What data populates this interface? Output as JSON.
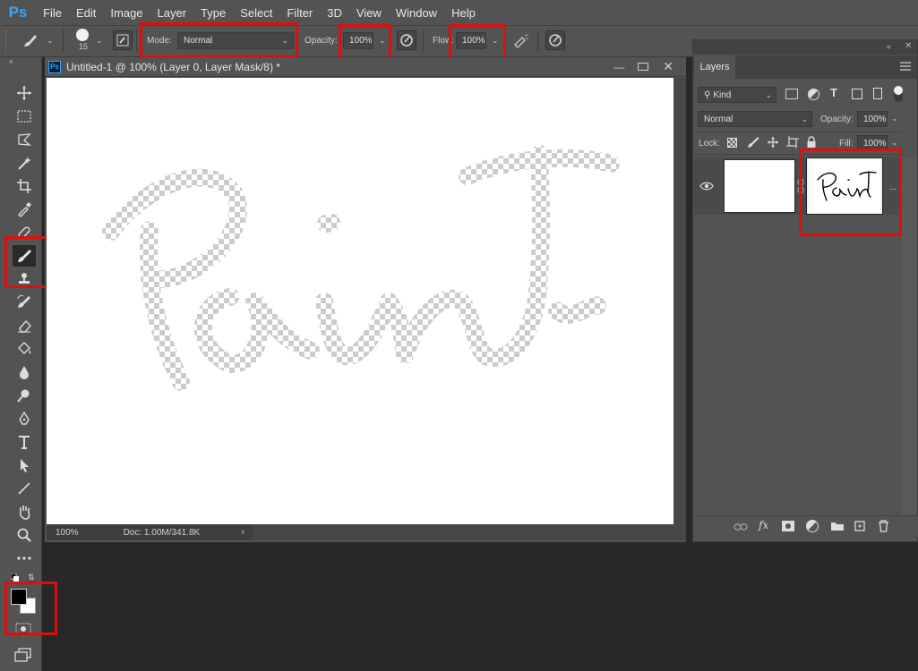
{
  "app": {
    "logo": "Ps",
    "menu": [
      "File",
      "Edit",
      "Image",
      "Layer",
      "Type",
      "Select",
      "Filter",
      "3D",
      "View",
      "Window",
      "Help"
    ]
  },
  "options": {
    "brush_size": "15",
    "mode_label": "Mode:",
    "mode_value": "Normal",
    "opacity_label": "Opacity:",
    "opacity_value": "100%",
    "flow_label": "Flow:",
    "flow_value": "100%"
  },
  "document": {
    "tab_icon": "Ps",
    "title": "Untitled-1 @ 100% (Layer 0, Layer Mask/8) *",
    "canvas_text": "Paint",
    "zoom": "100%",
    "doc_size": "Doc: 1.00M/341.8K"
  },
  "layers_panel": {
    "tab": "Layers",
    "filter_kind": "Kind",
    "blend_mode": "Normal",
    "opacity_label": "Opacity:",
    "opacity_value": "100%",
    "lock_label": "Lock:",
    "fill_label": "Fill:",
    "fill_value": "100%",
    "mask_thumb_text": "PainT",
    "more": "..."
  },
  "colors": {
    "accent": "#31a8ff",
    "highlight": "#e10d0d",
    "panel": "#535353",
    "background": "#282828"
  }
}
